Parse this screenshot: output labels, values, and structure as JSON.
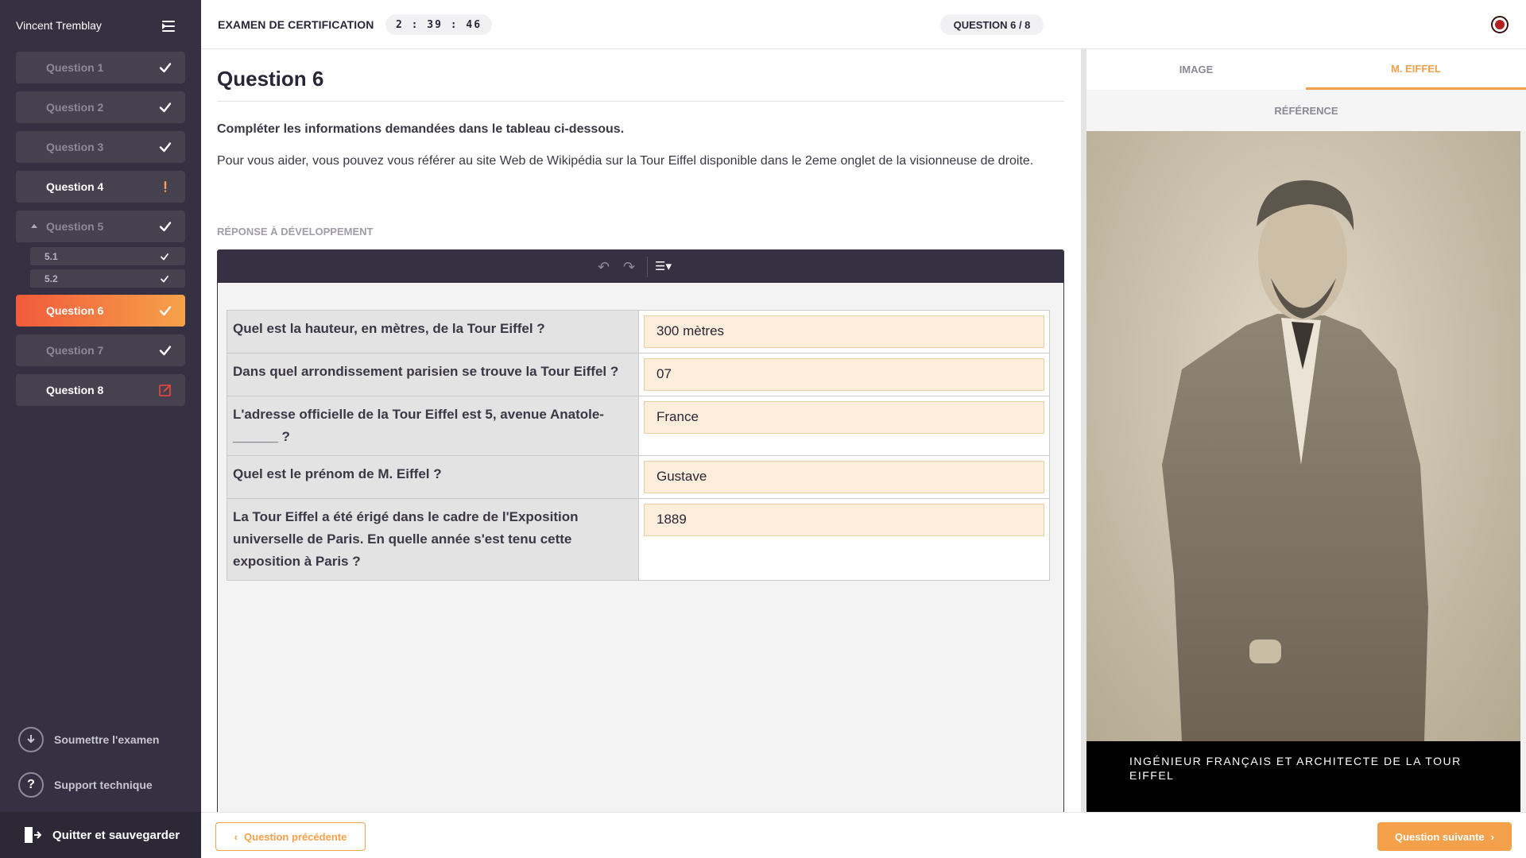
{
  "user": {
    "name": "Vincent Tremblay"
  },
  "sidebar": {
    "questions": [
      {
        "label": "Question 1",
        "status": "done"
      },
      {
        "label": "Question 2",
        "status": "done"
      },
      {
        "label": "Question 3",
        "status": "done"
      },
      {
        "label": "Question 4",
        "status": "warning"
      },
      {
        "label": "Question 5",
        "status": "done",
        "expanded": true,
        "subs": [
          {
            "label": "5.1",
            "status": "done"
          },
          {
            "label": "5.2",
            "status": "done"
          }
        ]
      },
      {
        "label": "Question 6",
        "status": "done",
        "active": true
      },
      {
        "label": "Question 7",
        "status": "done"
      },
      {
        "label": "Question 8",
        "status": "edit"
      }
    ],
    "submit_label": "Soumettre l'examen",
    "support_label": "Support technique",
    "quit_label": "Quitter et sauvegarder"
  },
  "header": {
    "exam_title": "EXAMEN DE CERTIFICATION",
    "timer": "2 : 39 : 46",
    "question_counter": "QUESTION 6 / 8"
  },
  "question": {
    "title": "Question 6",
    "instruction_bold": "Compléter les informations demandées dans le tableau ci-dessous.",
    "instruction": "Pour vous aider, vous pouvez vous référer au site Web de Wikipédia sur la Tour Eiffel disponible dans le 2eme onglet de la visionneuse de droite.",
    "response_label": "RÉPONSE À DÉVELOPPEMENT",
    "rows": [
      {
        "question": "Quel est la hauteur, en mètres, de la Tour Eiffel ?",
        "answer": "300 mètres"
      },
      {
        "question": "Dans quel arrondissement parisien se trouve la Tour Eiffel ?",
        "answer": "07"
      },
      {
        "question": "L'adresse officielle de la Tour Eiffel est 5, avenue Anatole-______ ?",
        "answer": "France"
      },
      {
        "question": "Quel est le prénom de M. Eiffel ?",
        "answer": "Gustave"
      },
      {
        "question": "La Tour Eiffel a été érigé dans le cadre de l'Exposition universelle de Paris. En quelle année s'est tenu cette exposition à Paris ?",
        "answer": "1889"
      }
    ]
  },
  "viewer": {
    "tabs": [
      {
        "label": "IMAGE",
        "active": false
      },
      {
        "label": "M. EIFFEL",
        "active": true
      }
    ],
    "subheader": "RÉFÉRENCE",
    "caption": "INGÉNIEUR FRANÇAIS ET ARCHITECTE DE LA TOUR EIFFEL"
  },
  "footer": {
    "prev_label": "Question précédente",
    "next_label": "Question suivante"
  },
  "colors": {
    "accent": "#f5a04a",
    "active_gradient_start": "#f25a3b",
    "sidebar_bg": "#353042",
    "answer_bg": "#fdeedb"
  }
}
